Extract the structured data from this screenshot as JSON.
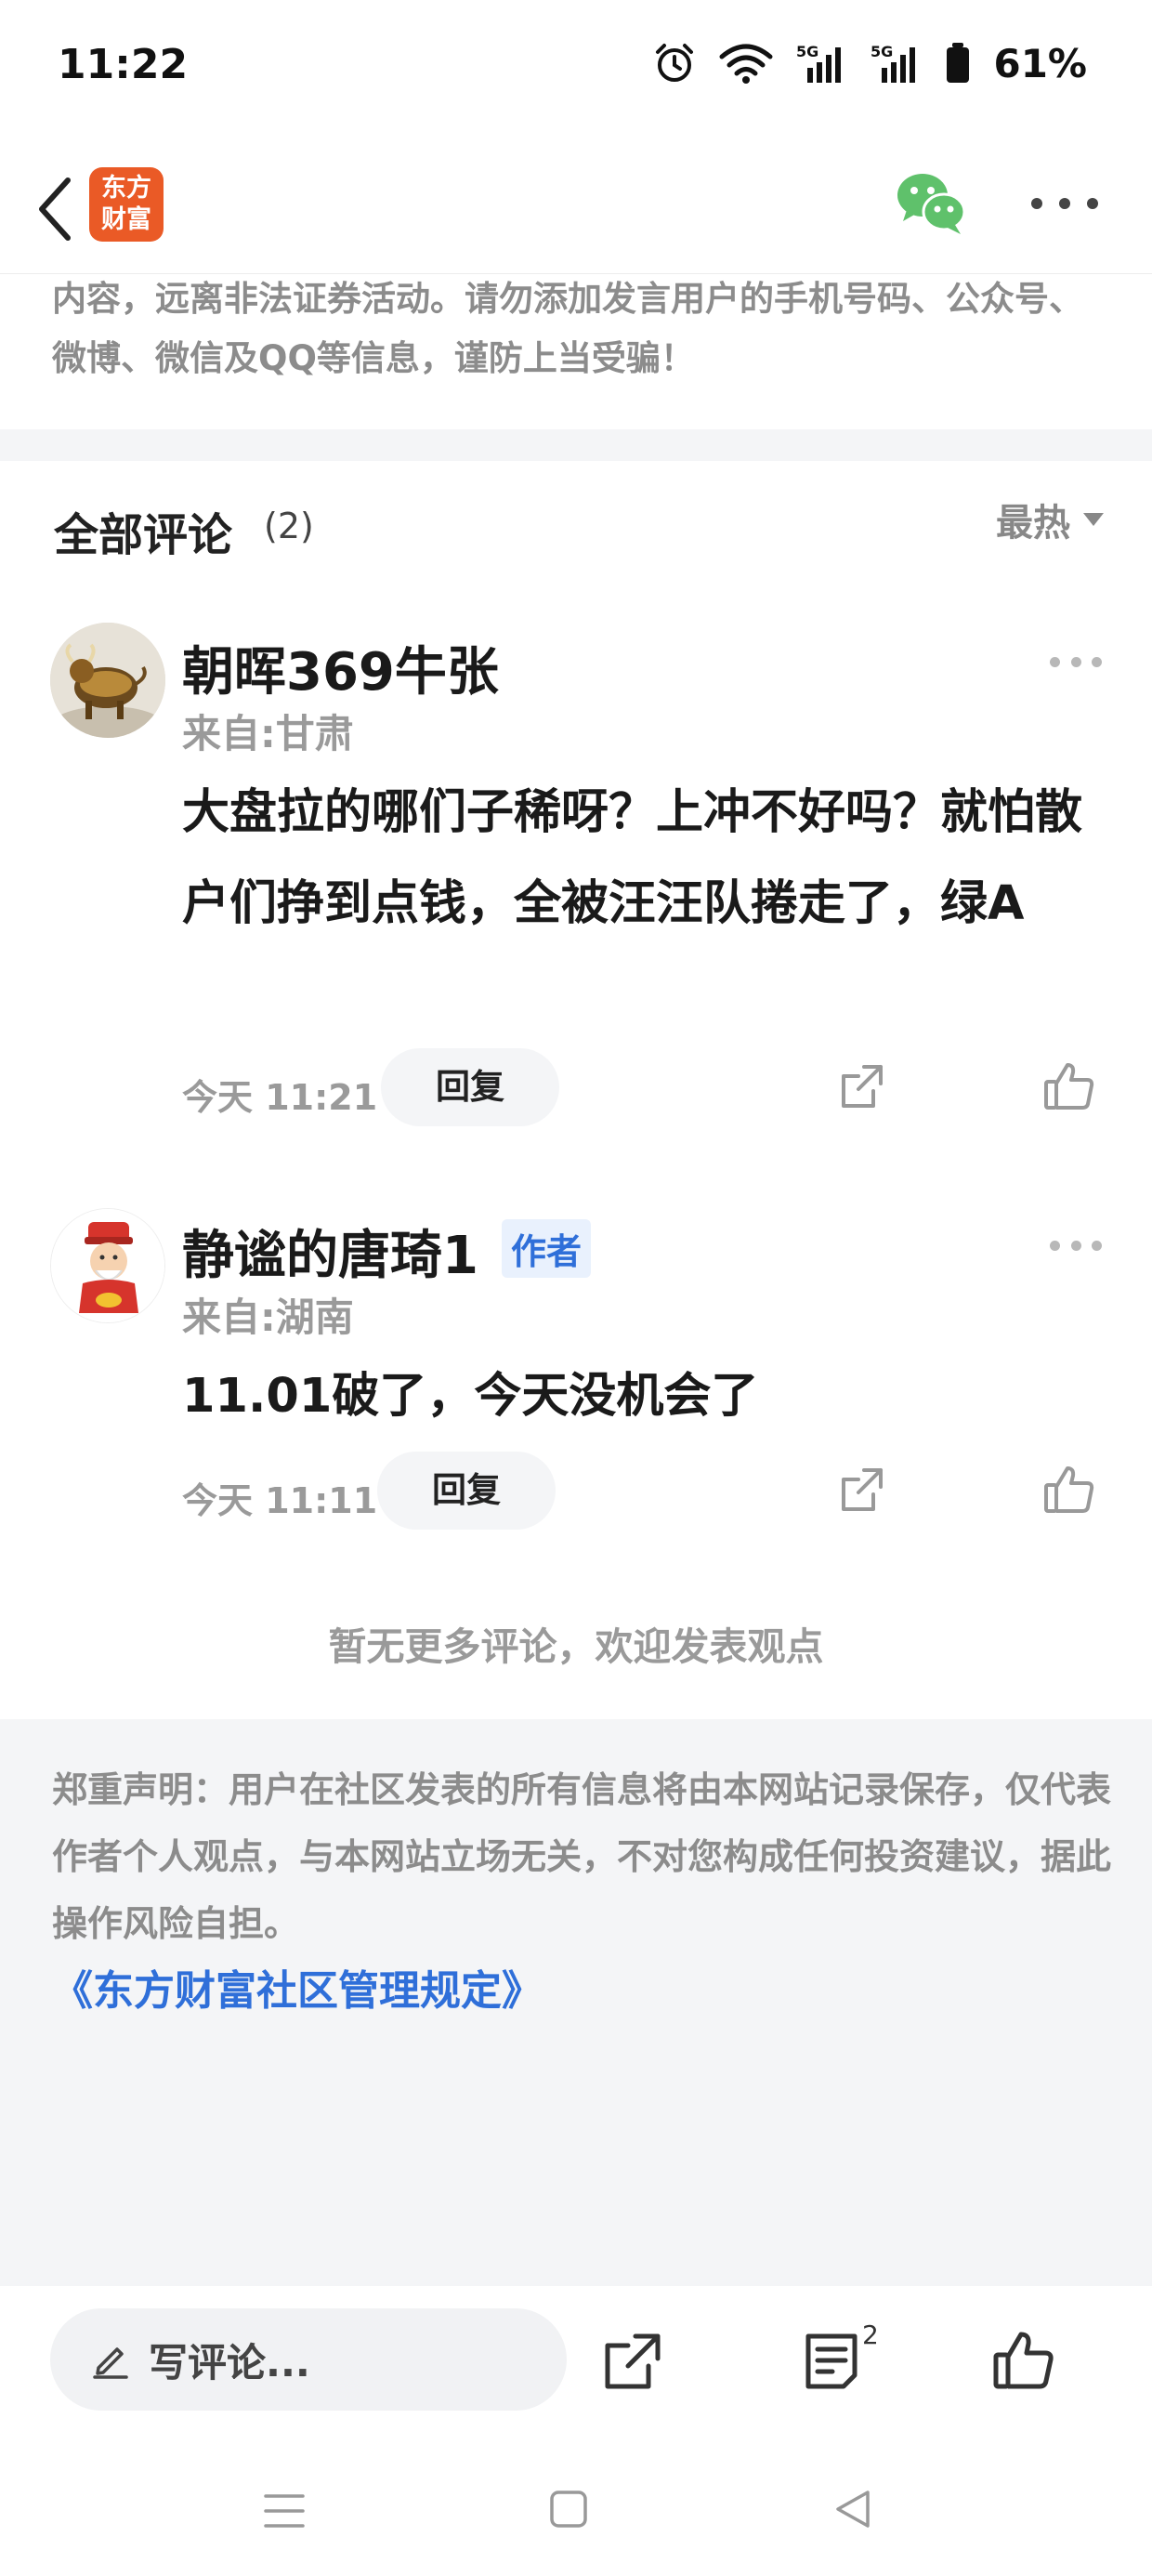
{
  "status_bar": {
    "time": "11:22",
    "battery": "61%",
    "icons": [
      "alarm-icon",
      "wifi-icon",
      "signal-5g-icon",
      "signal-5g-icon",
      "battery-icon"
    ]
  },
  "nav": {
    "logo_line1": "东方",
    "logo_line2": "财富",
    "icons": [
      "back-icon",
      "wechat-icon",
      "more-icon"
    ]
  },
  "notice_top": "内容，远离非法证券活动。请勿添加发言用户的手机号码、公众号、微博、微信及QQ等信息，谨防上当受骗！",
  "comments_header": {
    "title": "全部评论",
    "count": "(2)",
    "sort": "最热"
  },
  "comments": [
    {
      "name": "朝晖369牛张",
      "location": "来自:甘肃",
      "text": "大盘拉的哪们子稀呀？上冲不好吗？就怕散户们挣到点钱，全被汪汪队捲走了，绿A",
      "time": "今天 11:21",
      "reply": "回复",
      "avatar": "bull-avatar"
    },
    {
      "name": "静谧的唐琦1",
      "tag": "作者",
      "location": "来自:湖南",
      "text": "11.01破了，今天没机会了",
      "time": "今天 11:11",
      "reply": "回复",
      "avatar": "fortune-god-avatar"
    }
  ],
  "no_more": "暂无更多评论，欢迎发表观点",
  "disclaimer": {
    "text": "郑重声明：用户在社区发表的所有信息将由本网站记录保存，仅代表作者个人观点，与本网站立场无关，不对您构成任何投资建议，据此操作风险自担。",
    "link": "《东方财富社区管理规定》"
  },
  "bottom_bar": {
    "write_placeholder": "写评论...",
    "comment_count": "2",
    "icons": [
      "pencil-icon",
      "share-icon",
      "comments-icon",
      "like-icon"
    ]
  },
  "colors": {
    "brand": "#ea5a26",
    "link": "#2f6fd9",
    "wechat": "#5fc16b",
    "muted": "#9a9a9a",
    "band": "#f4f5f7"
  }
}
